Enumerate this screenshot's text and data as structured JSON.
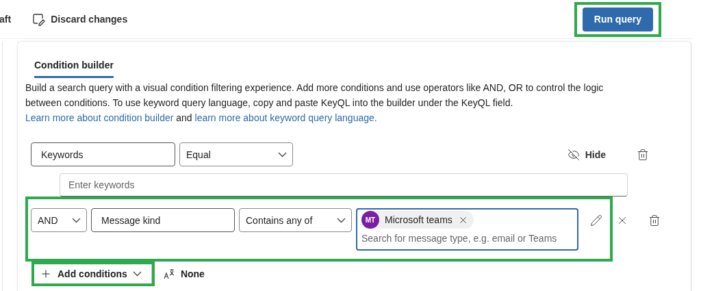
{
  "toolbar": {
    "items": [
      {
        "kind": "text",
        "label": "aft"
      },
      {
        "kind": "discard",
        "label": "Discard changes"
      }
    ],
    "run_button": {
      "label": "Run query",
      "highlighted": true
    }
  },
  "tabs": [
    {
      "label": "Condition builder",
      "selected": true
    }
  ],
  "description": [
    {
      "text": "Build a search query with a visual condition filtering experience. Add more conditions and use operators like AND, OR to control the logic between conditions. To use keyword query language, copy and paste KeyQL into the builder under the KeyQL field. ",
      "kind": "text"
    },
    {
      "text": "Learn more about condition builder",
      "kind": "link"
    },
    {
      "text": " and ",
      "kind": "text"
    },
    {
      "text": "learn more about keyword query language.",
      "kind": "link"
    }
  ],
  "conditions": [
    {
      "kind": "keywords",
      "field": "Keywords",
      "comparison": "Equal",
      "hide_label": "Hide",
      "placeholder": "Enter keywords"
    },
    {
      "kind": "picker",
      "connector": "AND",
      "field": "Message kind",
      "comparison": "Contains any of",
      "tags": [
        {
          "initials": "MT",
          "label": "Microsoft teams",
          "color": "#7b1fa2"
        }
      ],
      "placeholder": "Search for message type, e.g. email or Teams",
      "highlighted": true
    }
  ],
  "footer": {
    "add_button": {
      "label": "Add conditions",
      "highlighted": true
    },
    "language": {
      "label": "None"
    }
  }
}
